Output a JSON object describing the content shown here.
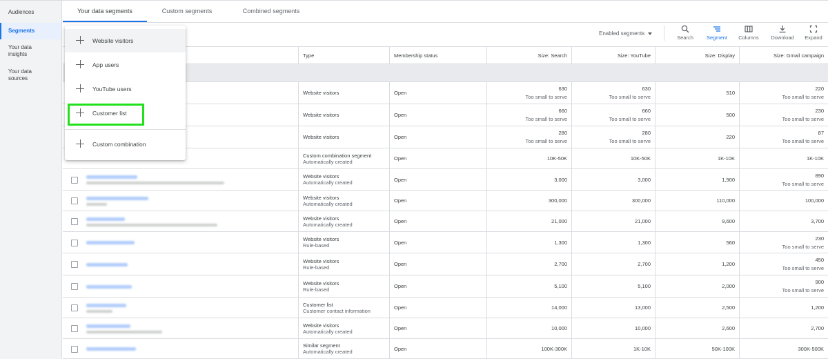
{
  "sidebar": {
    "items": [
      {
        "label": "Audiences"
      },
      {
        "label": "Segments"
      },
      {
        "label": "Your data insights"
      },
      {
        "label": "Your data sources"
      }
    ]
  },
  "tabs": [
    {
      "label": "Your data segments"
    },
    {
      "label": "Custom segments"
    },
    {
      "label": "Combined segments"
    }
  ],
  "toolbar": {
    "filter_label": "Enabled segments",
    "buttons": [
      {
        "label": "Search",
        "icon": "search-icon"
      },
      {
        "label": "Segment",
        "icon": "segment-icon"
      },
      {
        "label": "Columns",
        "icon": "columns-icon"
      },
      {
        "label": "Download",
        "icon": "download-icon"
      },
      {
        "label": "Expand",
        "icon": "expand-icon"
      }
    ]
  },
  "table": {
    "headers": {
      "type": "Type",
      "membership": "Membership status",
      "search": "Size: Search",
      "youtube": "Size: YouTube",
      "display": "Size: Display",
      "gmail": "Size: Gmail campaign"
    },
    "rows": [
      {
        "type": "Website visitors",
        "type_sub": "",
        "membership": "Open",
        "search": "630",
        "search_note": "Too small to serve",
        "youtube": "630",
        "youtube_note": "Too small to serve",
        "display": "510",
        "display_note": "",
        "gmail": "220",
        "gmail_note": "Too small to serve"
      },
      {
        "type": "Website visitors",
        "type_sub": "",
        "membership": "Open",
        "search": "660",
        "search_note": "Too small to serve",
        "youtube": "660",
        "youtube_note": "Too small to serve",
        "display": "500",
        "display_note": "",
        "gmail": "230",
        "gmail_note": "Too small to serve"
      },
      {
        "type": "Website visitors",
        "type_sub": "",
        "membership": "Open",
        "search": "280",
        "search_note": "Too small to serve",
        "youtube": "280",
        "youtube_note": "Too small to serve",
        "display": "220",
        "display_note": "",
        "gmail": "87",
        "gmail_note": "Too small to serve"
      },
      {
        "type": "Custom combination segment",
        "type_sub": "Automatically created",
        "membership": "Open",
        "search": "10K-50K",
        "search_note": "",
        "youtube": "10K-50K",
        "youtube_note": "",
        "display": "1K-10K",
        "display_note": "",
        "gmail": "1K-10K",
        "gmail_note": ""
      },
      {
        "type": "Website visitors",
        "type_sub": "Automatically created",
        "membership": "Open",
        "search": "3,000",
        "search_note": "",
        "youtube": "3,000",
        "youtube_note": "",
        "display": "1,900",
        "display_note": "",
        "gmail": "890",
        "gmail_note": "Too small to serve"
      },
      {
        "type": "Website visitors",
        "type_sub": "Automatically created",
        "membership": "Open",
        "search": "300,000",
        "search_note": "",
        "youtube": "300,000",
        "youtube_note": "",
        "display": "110,000",
        "display_note": "",
        "gmail": "100,000",
        "gmail_note": ""
      },
      {
        "type": "Website visitors",
        "type_sub": "Automatically created",
        "membership": "Open",
        "search": "21,000",
        "search_note": "",
        "youtube": "21,000",
        "youtube_note": "",
        "display": "9,600",
        "display_note": "",
        "gmail": "3,700",
        "gmail_note": ""
      },
      {
        "type": "Website visitors",
        "type_sub": "Rule-based",
        "membership": "Open",
        "search": "1,300",
        "search_note": "",
        "youtube": "1,300",
        "youtube_note": "",
        "display": "560",
        "display_note": "",
        "gmail": "230",
        "gmail_note": "Too small to serve"
      },
      {
        "type": "Website visitors",
        "type_sub": "Rule-based",
        "membership": "Open",
        "search": "2,700",
        "search_note": "",
        "youtube": "2,700",
        "youtube_note": "",
        "display": "1,200",
        "display_note": "",
        "gmail": "450",
        "gmail_note": "Too small to serve"
      },
      {
        "type": "Website visitors",
        "type_sub": "Rule-based",
        "membership": "Open",
        "search": "5,100",
        "search_note": "",
        "youtube": "5,100",
        "youtube_note": "",
        "display": "2,000",
        "display_note": "",
        "gmail": "900",
        "gmail_note": "Too small to serve"
      },
      {
        "type": "Customer list",
        "type_sub": "Customer contact information",
        "membership": "Open",
        "search": "14,000",
        "search_note": "",
        "youtube": "13,000",
        "youtube_note": "",
        "display": "2,500",
        "display_note": "",
        "gmail": "1,200",
        "gmail_note": ""
      },
      {
        "type": "Website visitors",
        "type_sub": "Automatically created",
        "membership": "Open",
        "search": "10,000",
        "search_note": "",
        "youtube": "10,000",
        "youtube_note": "",
        "display": "2,600",
        "display_note": "",
        "gmail": "2,700",
        "gmail_note": ""
      },
      {
        "type": "Similar segment",
        "type_sub": "Automatically created",
        "membership": "Open",
        "search": "100K-300K",
        "search_note": "",
        "youtube": "1K-10K",
        "youtube_note": "",
        "display": "50K-100K",
        "display_note": "",
        "gmail": "300K-500K",
        "gmail_note": ""
      }
    ]
  },
  "menu": {
    "items": [
      {
        "label": "Website visitors"
      },
      {
        "label": "App users"
      },
      {
        "label": "YouTube users"
      },
      {
        "label": "Customer list"
      },
      {
        "label": "Custom combination"
      }
    ],
    "highlight_color": "#22e01c"
  },
  "colors": {
    "accent": "#1a73e8"
  }
}
